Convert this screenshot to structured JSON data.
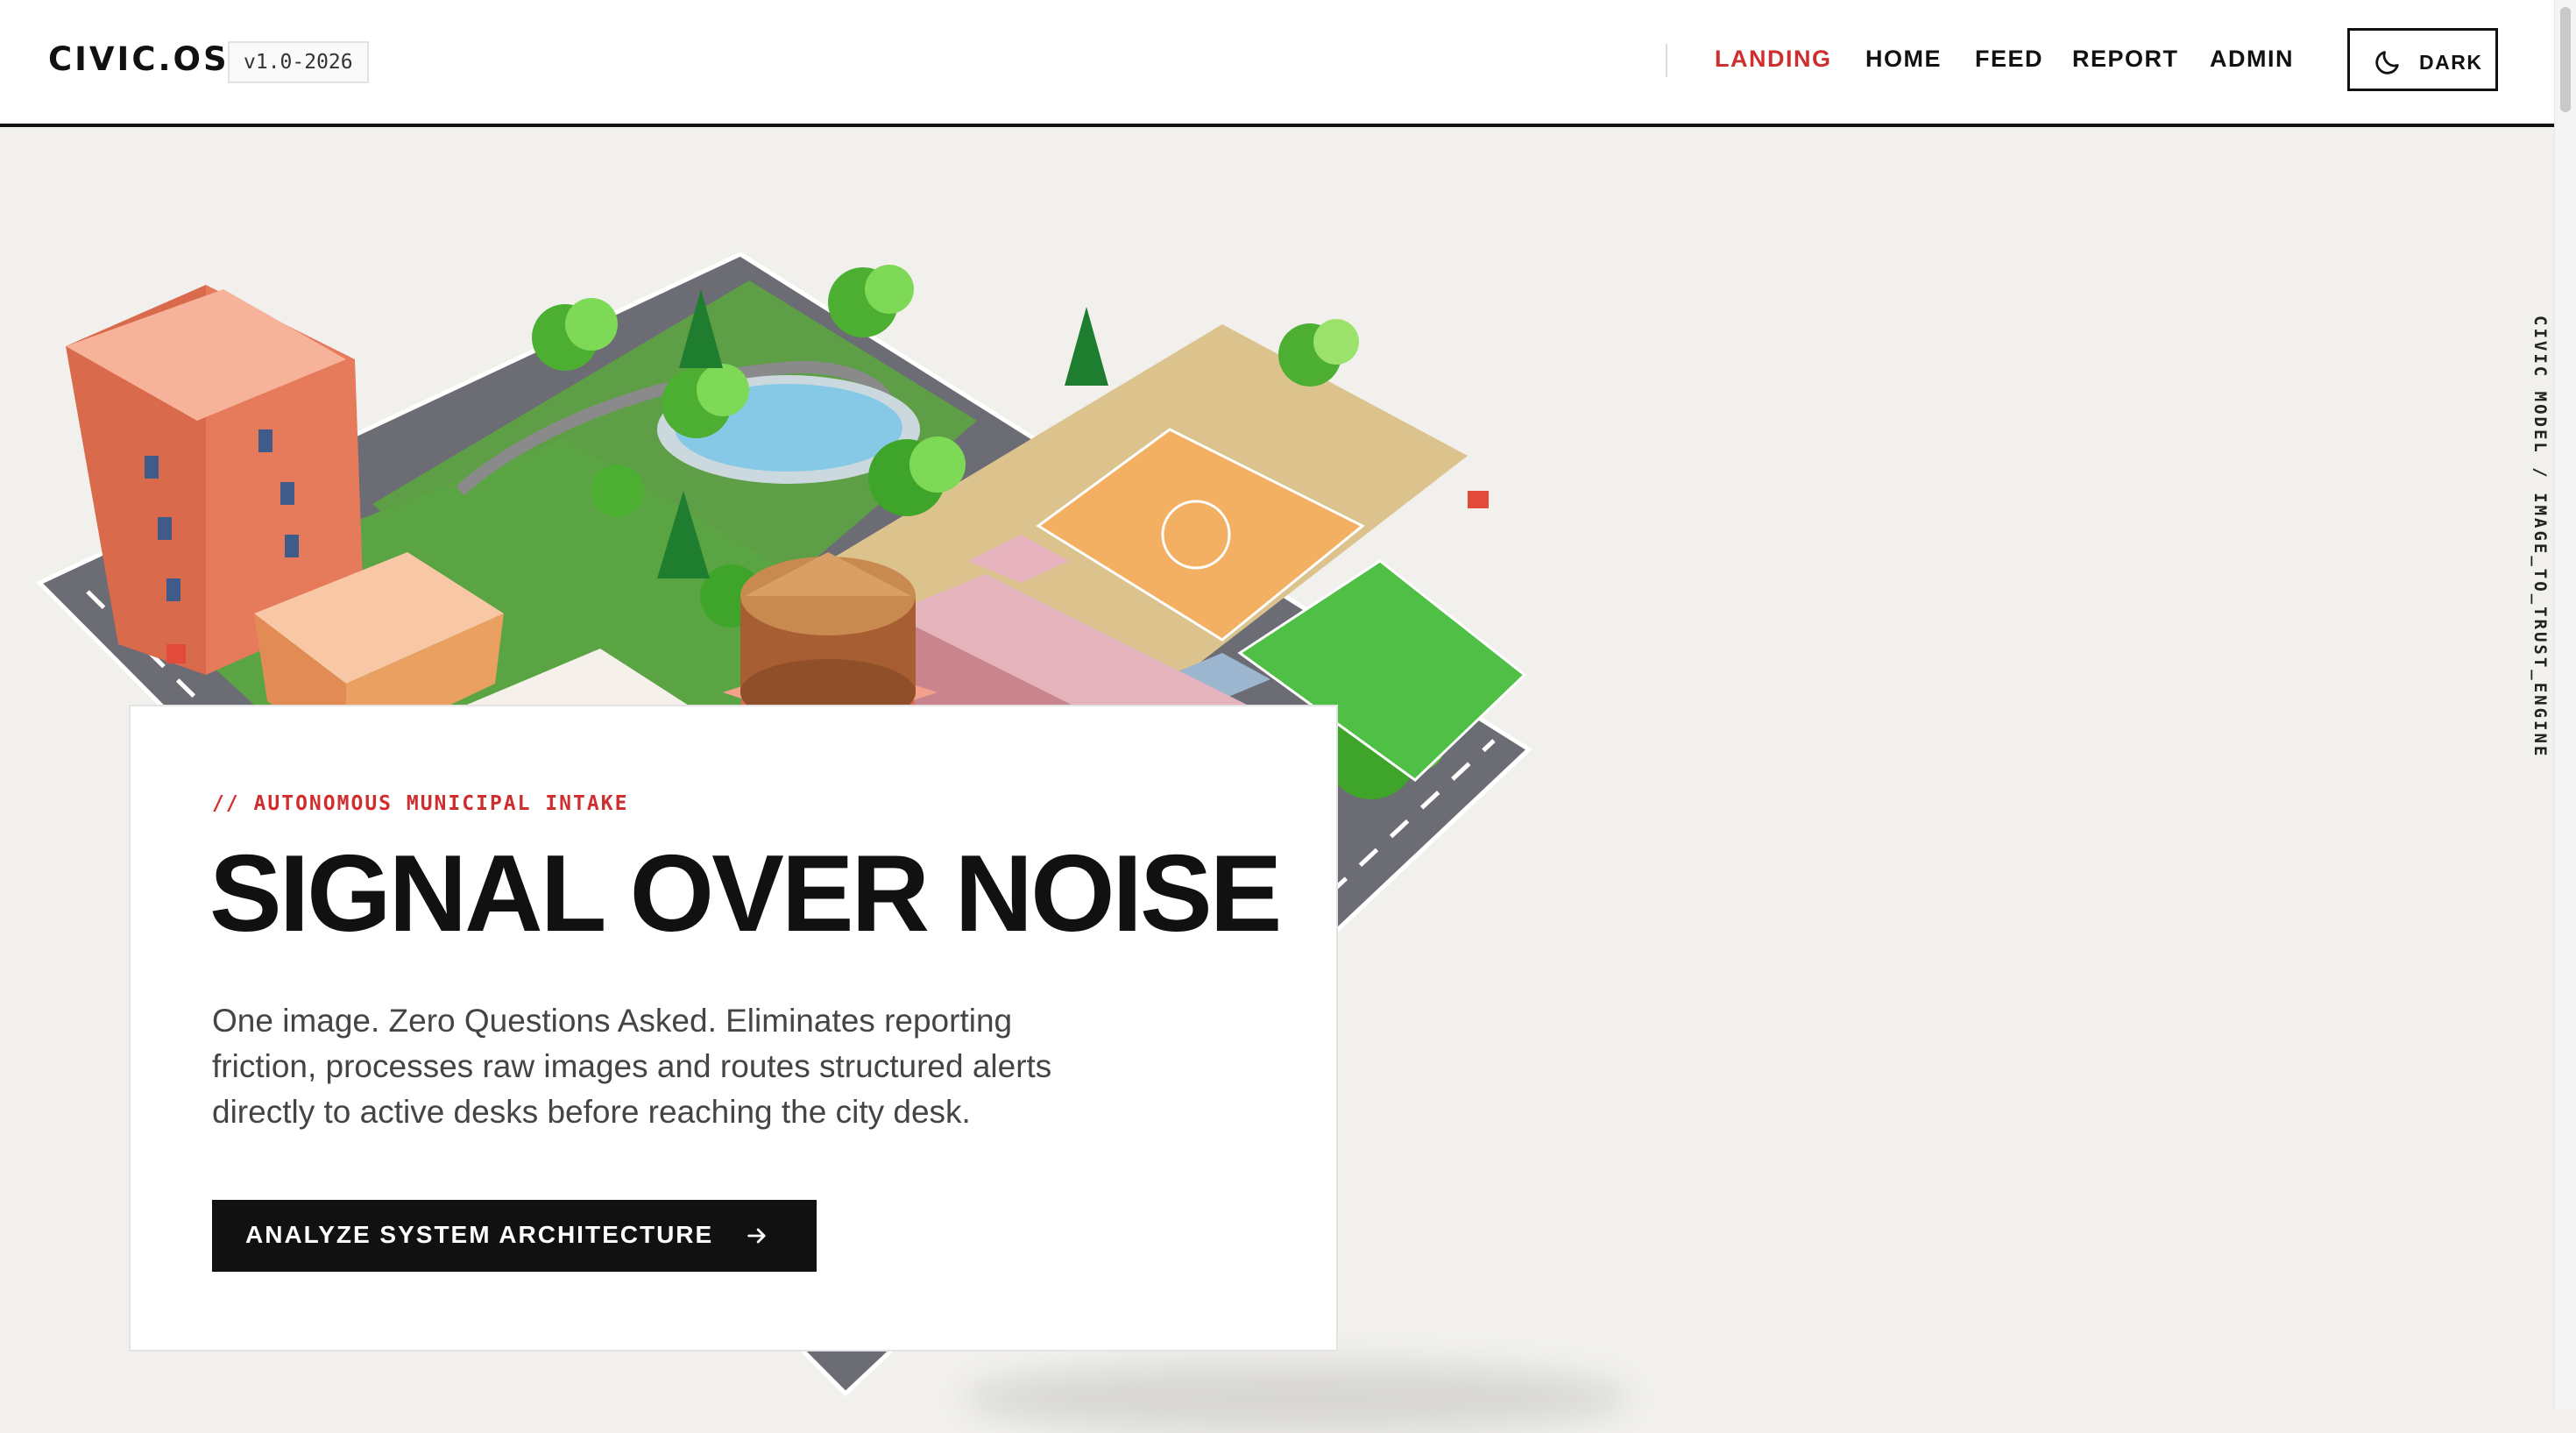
{
  "header": {
    "brand": "CIVIC.OS",
    "version": "v1.0-2026",
    "nav": [
      {
        "label": "LANDING",
        "active": true
      },
      {
        "label": "HOME",
        "active": false
      },
      {
        "label": "FEED",
        "active": false
      },
      {
        "label": "REPORT",
        "active": false
      },
      {
        "label": "ADMIN",
        "active": false
      }
    ],
    "theme_toggle": {
      "label": "DARK",
      "icon": "moon-icon"
    }
  },
  "hero": {
    "eyebrow": "// AUTONOMOUS MUNICIPAL INTAKE",
    "headline": "SIGNAL OVER NOISE",
    "body": "One image. Zero Questions Asked. Eliminates reporting friction, processes raw images and routes structured alerts directly to active desks before reaching the city desk.",
    "cta": {
      "label": "ANALYZE SYSTEM ARCHITECTURE",
      "icon": "arrow-right-icon"
    }
  },
  "model": {
    "side_label": "CIVIC MODEL / IMAGE_TO_TRUST_ENGINE"
  },
  "colors": {
    "accent": "#cf2e2e",
    "ink": "#111111",
    "page_bg": "#f1f0ed",
    "card_bg": "#ffffff"
  }
}
